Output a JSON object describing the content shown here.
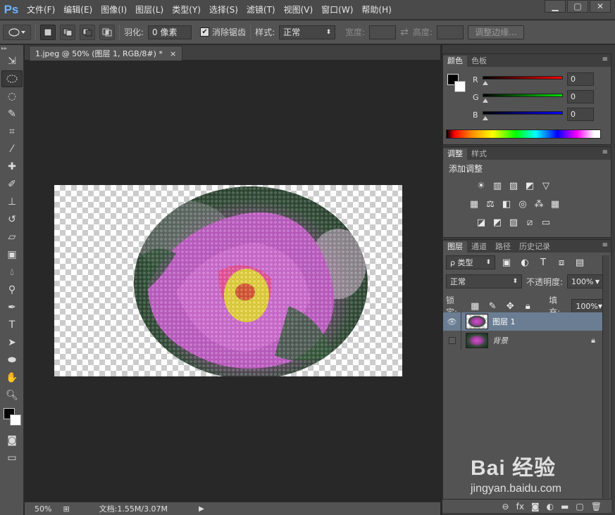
{
  "app": {
    "logo": "Ps"
  },
  "menu": [
    "文件(F)",
    "编辑(E)",
    "图像(I)",
    "图层(L)",
    "类型(Y)",
    "选择(S)",
    "滤镜(T)",
    "视图(V)",
    "窗口(W)",
    "帮助(H)"
  ],
  "window_controls": {
    "minimize": "▁",
    "restore": "▢",
    "close": "✕"
  },
  "options": {
    "feather_label": "羽化:",
    "feather_value": "0 像素",
    "antialias_label": "消除锯齿",
    "antialias_checked": true,
    "style_label": "样式:",
    "style_value": "正常",
    "width_label": "宽度:",
    "height_label": "高度:",
    "refine_edge": "调整边缘..."
  },
  "document": {
    "tab_title": "1.jpeg @ 50% (图层 1, RGB/8#) *",
    "tab_close": "×",
    "zoom": "50%",
    "doc_info": "文档:1.55M/3.07M"
  },
  "color_panel": {
    "tabs": [
      "颜色",
      "色板"
    ],
    "channels": [
      {
        "label": "R",
        "value": "0",
        "color": "#ff0000"
      },
      {
        "label": "G",
        "value": "0",
        "color": "#00c000"
      },
      {
        "label": "B",
        "value": "0",
        "color": "#0000ff"
      }
    ]
  },
  "adjustments_panel": {
    "tabs": [
      "调整",
      "样式"
    ],
    "heading": "添加调整",
    "row1": [
      "☀",
      "▥",
      "▨",
      "◩",
      "▽"
    ],
    "row2": [
      "▦",
      "⚖",
      "◧",
      "◎",
      "⁂",
      "▦"
    ],
    "row3": [
      "◪",
      "◩",
      "▨",
      "⧄",
      "▭"
    ]
  },
  "layers_panel": {
    "tabs": [
      "图层",
      "通道",
      "路径",
      "历史记录"
    ],
    "filter_label": "ρ 类型",
    "blend_mode": "正常",
    "opacity_label": "不透明度:",
    "opacity_value": "100%",
    "lock_label": "锁定:",
    "fill_label": "填充:",
    "fill_value": "100%",
    "layers": [
      {
        "name": "图层 1",
        "visible": true,
        "selected": true
      },
      {
        "name": "背景",
        "visible": false,
        "selected": false,
        "locked": true
      }
    ],
    "bottom_icons": [
      "link-icon",
      "fx-icon",
      "mask-icon",
      "adjustment-icon",
      "folder-icon",
      "new-layer-icon",
      "trash-icon"
    ]
  },
  "watermark": {
    "brand": "Bai 经验",
    "url": "jingyan.baidu.com"
  },
  "colors": {
    "accent": "#6fb3ff",
    "selected_layer": "#6a7d93"
  }
}
